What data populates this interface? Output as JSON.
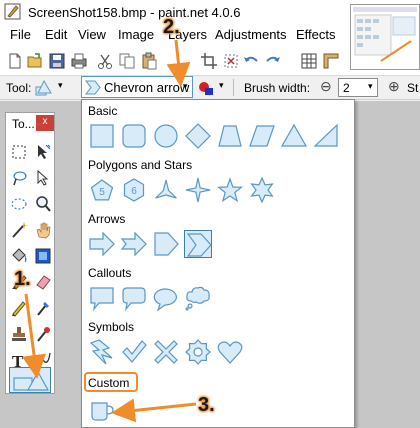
{
  "window": {
    "title": "ScreenShot158.bmp - paint.net 4.0.6"
  },
  "menu": [
    "File",
    "Edit",
    "View",
    "Image",
    "Layers",
    "Adjustments",
    "Effects"
  ],
  "options_bar": {
    "tool_label": "Tool:",
    "shape_dropdown_value": "Chevron arrow",
    "brush_width_label": "Brush width:",
    "brush_width_value": "2",
    "minus_label": "⊖",
    "plus_label": "⊕",
    "trailing_label": "St"
  },
  "tools_panel": {
    "title": "To...",
    "close_label": "x"
  },
  "shape_menu": {
    "sections": [
      {
        "label": "Basic",
        "shapes": [
          "rectangle-icon",
          "rounded-rectangle-icon",
          "ellipse-icon",
          "diamond-icon",
          "trapezoid-icon",
          "parallelogram-icon",
          "triangle-icon",
          "right-triangle-icon"
        ]
      },
      {
        "label": "Polygons and Stars",
        "shapes": [
          "pentagon-icon",
          "hexagon-icon",
          "three-point-star-icon",
          "four-point-star-icon",
          "five-point-star-icon",
          "six-point-star-icon"
        ]
      },
      {
        "label": "Arrows",
        "shapes": [
          "arrow-icon",
          "notched-arrow-icon",
          "pentagon-arrow-icon",
          "chevron-arrow-icon"
        ]
      },
      {
        "label": "Callouts",
        "shapes": [
          "rectangle-callout-icon",
          "rounded-callout-icon",
          "oval-callout-icon",
          "cloud-callout-icon"
        ]
      },
      {
        "label": "Symbols",
        "shapes": [
          "lightning-icon",
          "checkmark-icon",
          "x-icon",
          "gear-icon",
          "heart-icon"
        ]
      },
      {
        "label": "Custom",
        "shapes": [
          "cup-icon"
        ]
      }
    ],
    "selected_shape": "chevron-arrow-icon"
  },
  "annotations": [
    "1.",
    "2.",
    "3."
  ],
  "colors": {
    "accent": "#f08c2a",
    "shape_fill": "#d8ebf8",
    "shape_stroke": "#5b97c5",
    "selection": "#3c7fb1"
  }
}
